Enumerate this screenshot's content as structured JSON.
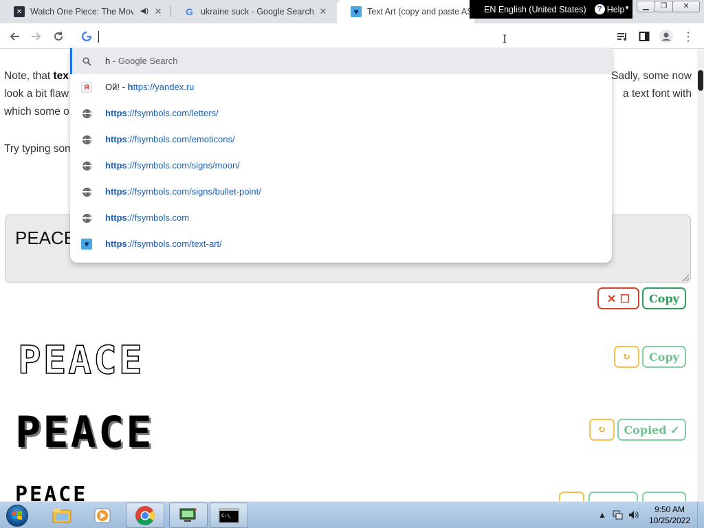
{
  "tabs": [
    {
      "title": "Watch One Piece: The Movie",
      "favicon": "video-site-icon"
    },
    {
      "title": "ukraine suck - Google Search",
      "favicon": "google-icon"
    },
    {
      "title": "Text Art (copy and paste ASCII",
      "favicon": "heart-icon"
    }
  ],
  "ime": {
    "language": "EN English (United States)",
    "help": "Help"
  },
  "omnibox": {
    "value": ""
  },
  "suggestions": [
    {
      "prefix": "h",
      "rest": " - Google Search",
      "icon": "search-icon"
    },
    {
      "prefix": "Ой! - ",
      "bold": "h",
      "rest": "ttps://yandex.ru",
      "icon": "yandex-icon"
    },
    {
      "bold": "https",
      "rest": "://fsymbols.com/letters/",
      "icon": "globe-icon"
    },
    {
      "bold": "https",
      "rest": "://fsymbols.com/emoticons/",
      "icon": "globe-icon"
    },
    {
      "bold": "https",
      "rest": "://fsymbols.com/signs/moon/",
      "icon": "globe-icon"
    },
    {
      "bold": "https",
      "rest": "://fsymbols.com/signs/bullet-point/",
      "icon": "globe-icon"
    },
    {
      "bold": "https",
      "rest": "://fsymbols.com",
      "icon": "globe-icon"
    },
    {
      "bold": "https",
      "rest": "://fsymbols.com/text-art/",
      "icon": "heart-icon"
    }
  ],
  "page": {
    "line1_left_pre": "Note, that ",
    "line1_left_bold": "tex",
    "line1_right": "Sadly, some now",
    "line2_left": "look a bit flaw",
    "line2_right": "a text font with",
    "line3_left": "which some o",
    "try_text": "Try typing som",
    "input_value": "PEACE",
    "clear_label": "✕ ☐",
    "copy_label": "Copy",
    "copied_label": "Copied ✓",
    "refresh_label": "↻",
    "art": [
      "PEACE",
      "PEACE",
      "PEACE"
    ]
  },
  "taskbar": {
    "time": "9:50 AM",
    "date": "10/25/2022"
  },
  "colors": {
    "copy_green": "#2aa05a",
    "clear_red": "#d0452a",
    "refresh_yellow": "#f2c24a",
    "link_blue": "#1a5fb4",
    "selection_blue": "#1a73e8"
  }
}
